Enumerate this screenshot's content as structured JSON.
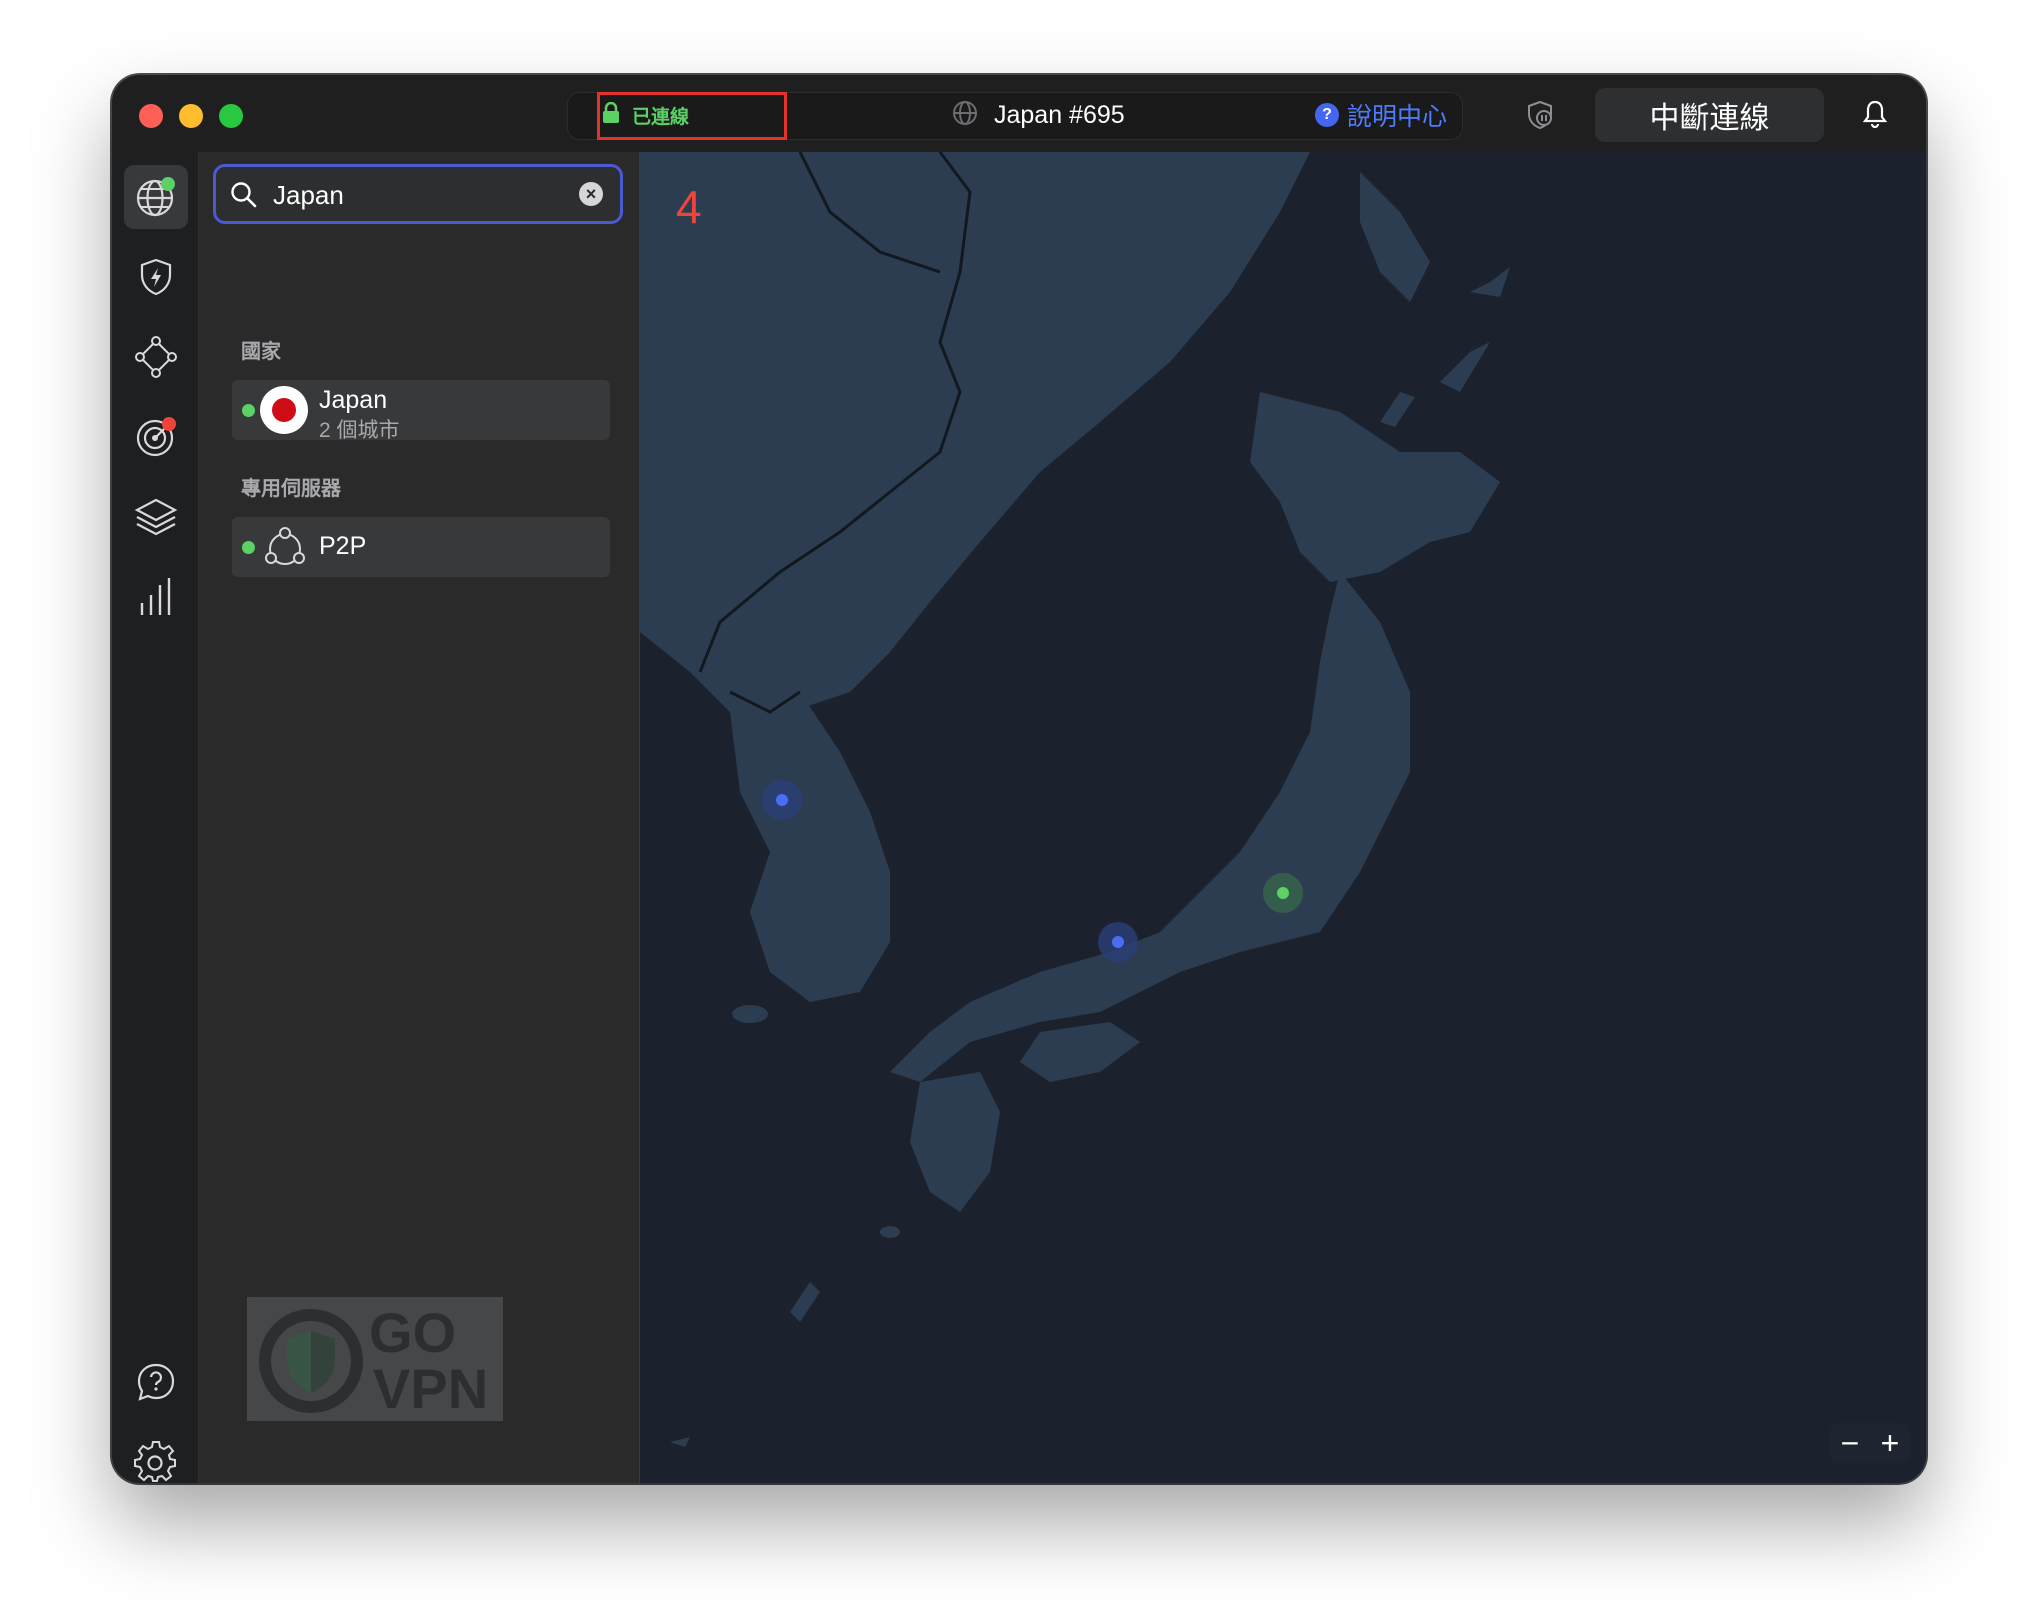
{
  "titlebar": {
    "status_text": "已連線",
    "server_name": "Japan #695",
    "help_label": "說明中心",
    "disconnect_label": "中斷連線"
  },
  "annotation": {
    "number": "4"
  },
  "search": {
    "value": "Japan"
  },
  "sections": {
    "countries_title": "國家",
    "specialty_title": "專用伺服器"
  },
  "countries": [
    {
      "name": "Japan",
      "subtitle": "2 個城市",
      "connected": true
    }
  ],
  "specialty": [
    {
      "name": "P2P",
      "connected": true
    }
  ],
  "watermark": {
    "line1": "GO",
    "line2": "VPN"
  },
  "map": {
    "zoom_out_label": "−",
    "zoom_in_label": "+",
    "pins": [
      {
        "name": "Seoul",
        "status": "available"
      },
      {
        "name": "Osaka",
        "status": "available"
      },
      {
        "name": "Tokyo",
        "status": "connected"
      }
    ]
  },
  "colors": {
    "connected_green": "#5bd166",
    "accent_blue": "#4a59d4",
    "highlight_red": "#e5322b",
    "map_land": "#2c3d51",
    "map_sea": "#1b222d"
  }
}
